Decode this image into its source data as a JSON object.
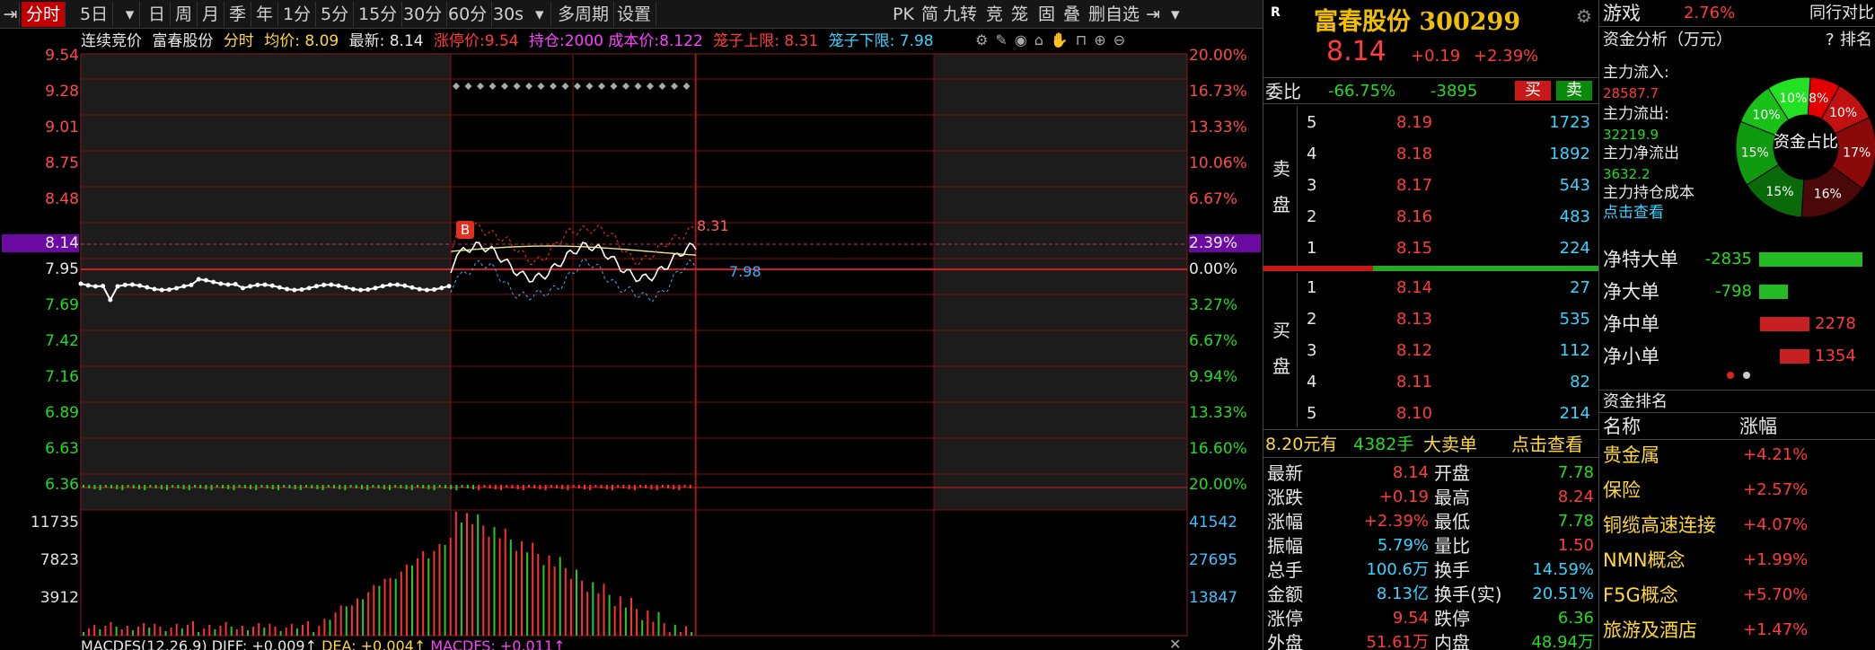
{
  "toolbar": {
    "items": [
      "分时",
      "5日",
      "日",
      "周",
      "月",
      "季",
      "年",
      "1分",
      "5分",
      "15分",
      "30分",
      "60分",
      "30s",
      "多周期",
      "设置"
    ],
    "right_items": [
      "PK",
      "简",
      "九转",
      "竞",
      "笼",
      "固",
      "叠",
      "删自选"
    ]
  },
  "chart": {
    "info": {
      "auction_label": "连续竞价",
      "stock_name": "富春股份",
      "mode": "分时",
      "avg_label": "均价: 8.09",
      "latest_label": "最新: 8.14",
      "limit_up_label": "涨停价:9.54",
      "position_label": "持仓:2000 成本价:8.122",
      "cage_upper_label": "笼子上限: 8.31",
      "cage_lower_label": "笼子下限: 7.98"
    },
    "left_prices": [
      "9.54",
      "9.28",
      "9.01",
      "8.75",
      "8.48",
      "8.14",
      "7.95",
      "7.69",
      "7.42",
      "7.16",
      "6.89",
      "6.63",
      "6.36"
    ],
    "right_pcts": [
      "20.00%",
      "16.73%",
      "13.33%",
      "10.06%",
      "6.67%",
      "2.39%",
      "0.00%",
      "3.27%",
      "6.67%",
      "9.94%",
      "13.33%",
      "16.60%",
      "20.00%"
    ],
    "vol_left": [
      "11735",
      "7823",
      "3912"
    ],
    "vol_right": [
      "41542",
      "27695",
      "13847"
    ],
    "cage_upper_value": "8.31",
    "cage_lower_value": "7.98",
    "buy_marker": "B",
    "macd": {
      "name": "MACDFS(12,26,9)",
      "diff": "DIFF: +0.009↑",
      "dea": "DEA: +0.004↑",
      "macdfs": "MACDFS: +0.011↑"
    },
    "colors": {
      "up": "#ff3b3b",
      "down": "#22dd22",
      "price_line": "#ffffff",
      "avg_line": "#f0e68c"
    }
  },
  "quote": {
    "name_code": "富春股份 300299",
    "price": "8.14",
    "change": "+0.19",
    "change_pct": "+2.39%",
    "weibi_label": "委比",
    "weibi_pct": "-66.75%",
    "weibi_diff": "-3895",
    "buy_btn": "买",
    "sell_btn": "卖",
    "sell_side_label": "卖盘",
    "buy_side_label": "买盘",
    "sells": [
      {
        "level": "5",
        "price": "8.19",
        "vol": "1723"
      },
      {
        "level": "4",
        "price": "8.18",
        "vol": "1892"
      },
      {
        "level": "3",
        "price": "8.17",
        "vol": "543"
      },
      {
        "level": "2",
        "price": "8.16",
        "vol": "483"
      },
      {
        "level": "1",
        "price": "8.15",
        "vol": "224"
      }
    ],
    "buys": [
      {
        "level": "1",
        "price": "8.14",
        "vol": "27"
      },
      {
        "level": "2",
        "price": "8.13",
        "vol": "535"
      },
      {
        "level": "3",
        "price": "8.12",
        "vol": "112"
      },
      {
        "level": "4",
        "price": "8.11",
        "vol": "82"
      },
      {
        "level": "5",
        "price": "8.10",
        "vol": "214"
      }
    ],
    "big_order": {
      "price": "8.20元有",
      "lots": "4382手",
      "kind": "大卖单",
      "link": "点击查看"
    },
    "stats_left": [
      {
        "label": "最新",
        "value": "8.14",
        "color": "red"
      },
      {
        "label": "涨跌",
        "value": "+0.19",
        "color": "red"
      },
      {
        "label": "涨幅",
        "value": "+2.39%",
        "color": "red"
      },
      {
        "label": "振幅",
        "value": "5.79%",
        "color": "cyan"
      },
      {
        "label": "总手",
        "value": "100.6万",
        "color": "cyan"
      },
      {
        "label": "金额",
        "value": "8.13亿",
        "color": "cyan"
      },
      {
        "label": "涨停",
        "value": "9.54",
        "color": "red"
      },
      {
        "label": "外盘",
        "value": "51.61万",
        "color": "red"
      }
    ],
    "stats_right": [
      {
        "label": "开盘",
        "value": "7.78",
        "color": "green"
      },
      {
        "label": "最高",
        "value": "8.24",
        "color": "red"
      },
      {
        "label": "最低",
        "value": "7.78",
        "color": "green"
      },
      {
        "label": "量比",
        "value": "1.50",
        "color": "red"
      },
      {
        "label": "换手",
        "value": "14.59%",
        "color": "cyan"
      },
      {
        "label": "换手(实)",
        "value": "20.51%",
        "color": "cyan"
      },
      {
        "label": "跌停",
        "value": "6.36",
        "color": "green"
      },
      {
        "label": "内盘",
        "value": "48.94万",
        "color": "green"
      }
    ]
  },
  "side": {
    "tab_game": "游戏",
    "tab_game_pct": "2.76%",
    "tab_industry": "同行对比",
    "fund_title": "资金分析（万元）",
    "rank_link": "排名",
    "help": "?",
    "inflow_label": "主力流入:",
    "inflow_value": "28587.7",
    "outflow_label": "主力流出:",
    "outflow_value": "32219.9",
    "net_label": "主力净流出",
    "net_value": "3632.2",
    "cost_label": "主力持仓成本",
    "cost_link": "点击查看",
    "donut_center": "资金占比",
    "donut_slices": [
      {
        "pct": 8,
        "label": "8%",
        "color": "#e00000"
      },
      {
        "pct": 10,
        "label": "10%",
        "color": "#c01010"
      },
      {
        "pct": 17,
        "label": "17%",
        "color": "#8a0a0a"
      },
      {
        "pct": 16,
        "label": "16%",
        "color": "#4a0808"
      },
      {
        "pct": 15,
        "label": "15%",
        "color": "#0a6a0a"
      },
      {
        "pct": 15,
        "label": "15%",
        "color": "#109a10"
      },
      {
        "pct": 10,
        "label": "10%",
        "color": "#18c018"
      },
      {
        "pct": 10,
        "label": "10%",
        "color": "#22e022"
      }
    ],
    "flows": [
      {
        "label": "净特大单",
        "value": "-2835",
        "fraction": 0.9,
        "color": "#22bb22"
      },
      {
        "label": "净大单",
        "value": "-798",
        "fraction": 0.25,
        "color": "#22bb22"
      },
      {
        "label": "净中单",
        "value": "2278",
        "fraction": 0.72,
        "color": "#c82020"
      },
      {
        "label": "净小单",
        "value": "1354",
        "fraction": 0.43,
        "color": "#c82020"
      }
    ],
    "rank_title": "资金排名",
    "rank_col_name": "名称",
    "rank_col_pct": "涨幅",
    "ranks": [
      {
        "name": "贵金属",
        "pct": "+4.21%"
      },
      {
        "name": "保险",
        "pct": "+2.57%"
      },
      {
        "name": "铜缆高速连接",
        "pct": "+4.07%"
      },
      {
        "name": "NMN概念",
        "pct": "+1.99%"
      },
      {
        "name": "F5G概念",
        "pct": "+5.70%"
      },
      {
        "name": "旅游及酒店",
        "pct": "+1.47%"
      }
    ]
  }
}
